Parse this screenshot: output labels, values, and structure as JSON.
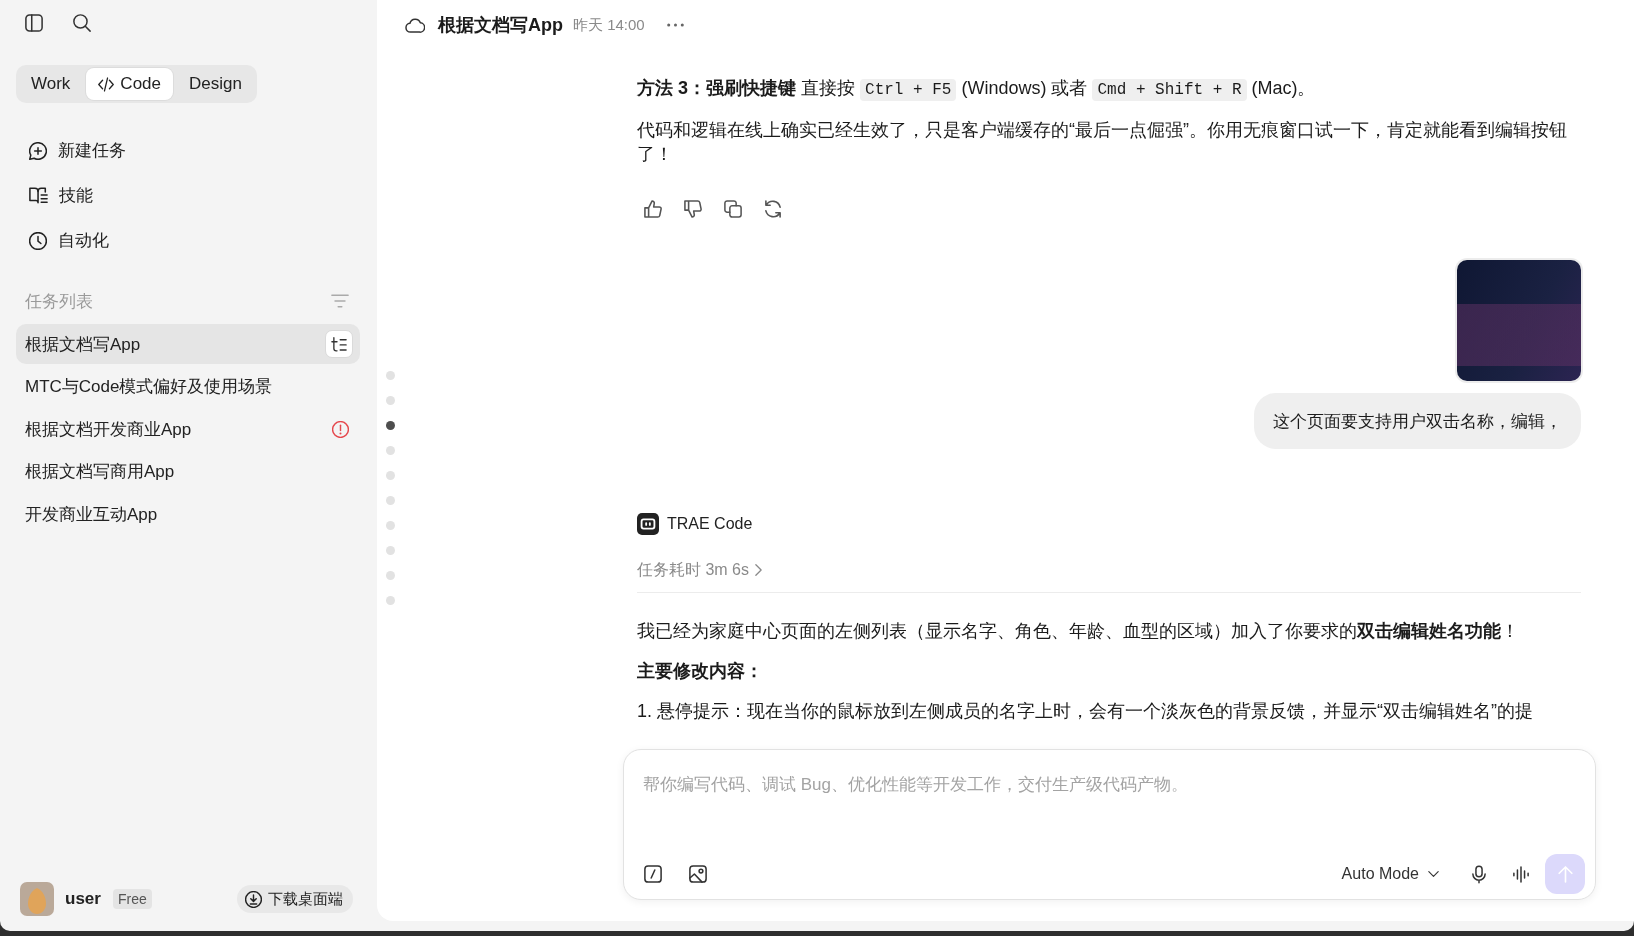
{
  "sidebar": {
    "modes": [
      {
        "kind": "work",
        "label": "Work",
        "selected": false
      },
      {
        "kind": "code",
        "label": "Code",
        "selected": true
      },
      {
        "kind": "design",
        "label": "Design",
        "selected": false
      }
    ],
    "nav_items": [
      {
        "kind": "new_task",
        "label": "新建任务"
      },
      {
        "kind": "skills",
        "label": "技能"
      },
      {
        "kind": "automation",
        "label": "自动化"
      }
    ],
    "task_list": {
      "title": "任务列表",
      "items": [
        {
          "label": "根据文档写App",
          "selected": true,
          "has_error": false
        },
        {
          "label": "MTC与Code模式偏好及使用场景",
          "selected": false,
          "has_error": false
        },
        {
          "label": "根据文档开发商业App",
          "selected": false,
          "has_error": true
        },
        {
          "label": "根据文档写商用App",
          "selected": false,
          "has_error": false
        },
        {
          "label": "开发商业互动App",
          "selected": false,
          "has_error": false
        }
      ]
    },
    "user": {
      "name": "user",
      "plan": "Free"
    },
    "download_button": "下载桌面端"
  },
  "header": {
    "title": "根据文档写App",
    "time": "昨天 14:00"
  },
  "nav_dots": [
    {
      "selected": false
    },
    {
      "selected": false
    },
    {
      "selected": true
    },
    {
      "selected": false
    },
    {
      "selected": false
    },
    {
      "selected": false
    },
    {
      "selected": false
    },
    {
      "selected": false
    },
    {
      "selected": false
    },
    {
      "selected": false
    }
  ],
  "messages": [
    {
      "kind": "assistant",
      "blocks": [
        {
          "kind": "paragraph",
          "segments": [
            {
              "kind": "text",
              "text": "**方法 3：强刷快捷键** 直接按 "
            },
            {
              "kind": "code",
              "text": "Ctrl + F5"
            },
            {
              "kind": "text",
              "text": " (Windows) 或者 "
            },
            {
              "kind": "code",
              "text": "Cmd + Shift + R"
            },
            {
              "kind": "text",
              "text": " (Mac)。"
            }
          ]
        },
        {
          "kind": "paragraph",
          "segments": [
            {
              "kind": "text",
              "text": "代码和逻辑在线上确实已经生效了，只是客户端缓存的“最后一点倔强”。你用无痕窗口试一下，肯定就能看到编辑按钮了！"
            }
          ]
        }
      ]
    },
    {
      "kind": "user",
      "attachments": [
        {
          "kind": "image"
        }
      ],
      "text": "这个页面要支持用户双击名称，编辑，"
    },
    {
      "kind": "assistant",
      "agent": "TRAE Code",
      "duration": "任务耗时 3m 6s",
      "blocks": [
        {
          "kind": "paragraph",
          "segments": [
            {
              "kind": "text",
              "text": "我已经为家庭中心页面的左侧列表（显示名字、角色、年龄、血型的区域）加入了你要求的**双击编辑姓名功能**！"
            }
          ]
        },
        {
          "kind": "heading",
          "segments": [
            {
              "kind": "text",
              "text": "主要修改内容："
            }
          ]
        },
        {
          "kind": "list_item",
          "segments": [
            {
              "kind": "text",
              "text": "1. 悬停提示：现在当你的鼠标放到左侧成员的名字上时，会有一个淡灰色的背景反馈，并显示“双击编辑姓名”的提"
            }
          ]
        }
      ]
    }
  ],
  "composer": {
    "placeholder": "帮你编写代码、调试 Bug、优化性能等开发工作，交付生产级代码产物。",
    "mode": "Auto Mode",
    "send_disabled": true
  }
}
